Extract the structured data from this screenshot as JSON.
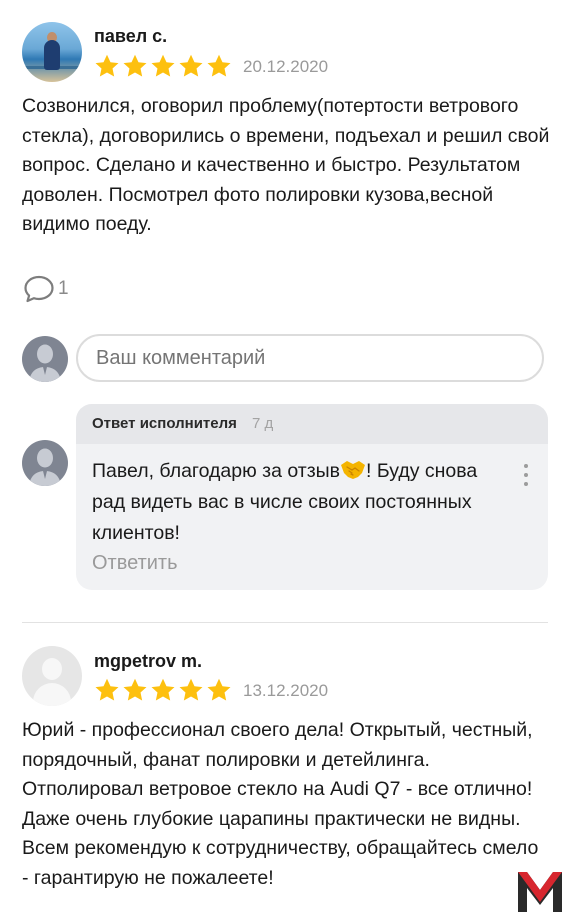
{
  "reviews": [
    {
      "author": "павел с.",
      "rating": 5,
      "date": "20.12.2020",
      "text": "Созвонился, оговорил проблему(потертости ветрового стекла), договорились о времени, подъехал и решил свой вопрос. Сделано и качественно и быстро. Результатом доволен. Посмотрел фото полировки кузова,весной видимо поеду.",
      "comments_count": "1",
      "avatar_icon": "user-photo"
    },
    {
      "author": "mgpetrov m.",
      "rating": 5,
      "date": "13.12.2020",
      "text": "Юрий - профессионал своего дела! Открытый, честный, порядочный, фанат полировки и детейлинга. Отполировал ветровое стекло на Audi Q7 - все отлично! Даже очень глубокие царапины практически не видны. Всем рекомендую к сотрудничеству, обращайтесь смело - гарантирую не пожалеете!",
      "avatar_icon": "default-user"
    }
  ],
  "comment_input": {
    "placeholder": "Ваш комментарий"
  },
  "reply": {
    "header_label": "Ответ исполнителя",
    "time_ago": "7 д",
    "text_before_emoji": "Павел, благодарю за отзыв",
    "emoji": "handshake",
    "text_after_emoji": "! Буду снова рад видеть вас в числе своих постоянных клиентов!",
    "answer_button": "Ответить"
  },
  "colors": {
    "star": "#fdc00f",
    "muted": "#9a9a9a",
    "reply_bg": "#f1f2f4",
    "logo_red": "#d7262e",
    "logo_dark": "#2a2a2a"
  },
  "icons": [
    "star-icon",
    "comment-icon",
    "more-vertical-icon",
    "handshake-emoji",
    "brand-logo"
  ]
}
